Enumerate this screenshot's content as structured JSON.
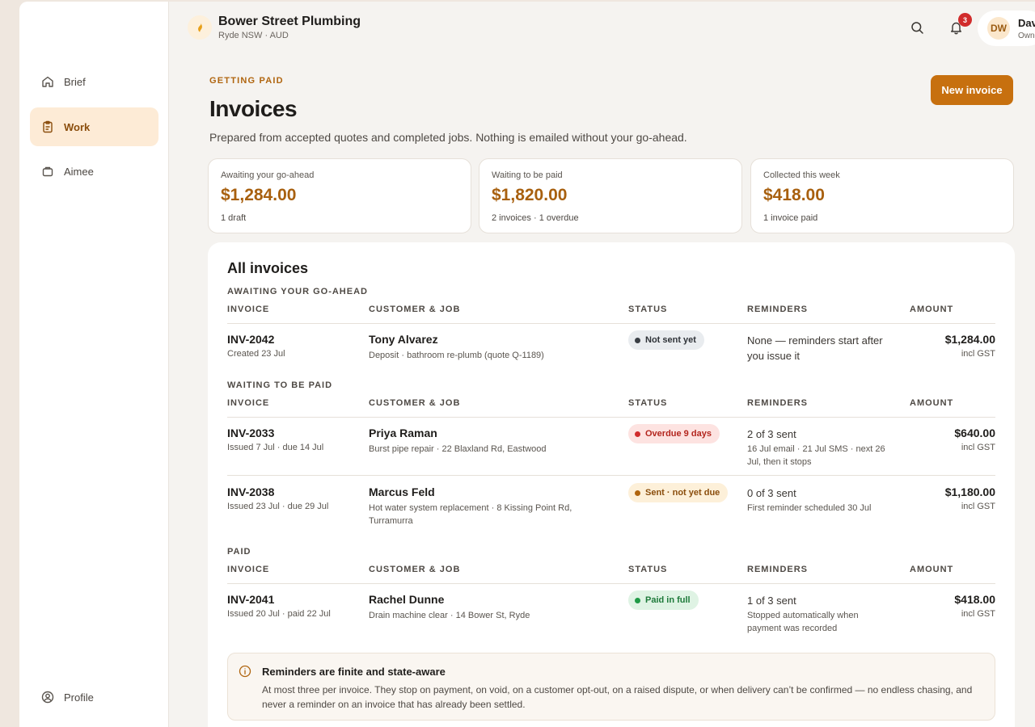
{
  "sidebar": {
    "items": [
      {
        "label": "Brief",
        "icon": "home-icon"
      },
      {
        "label": "Work",
        "icon": "clipboard-icon"
      },
      {
        "label": "Aimee",
        "icon": "bag-icon"
      }
    ],
    "profile": {
      "label": "Profile",
      "icon": "user-circle-icon"
    }
  },
  "topbar": {
    "business_name": "Bower Street Plumbing",
    "business_sub": "Ryde NSW · AUD",
    "notification_count": "3",
    "user_initials": "DW",
    "user_name": "Dave",
    "user_role": "Owner"
  },
  "header": {
    "eyebrow": "GETTING PAID",
    "title": "Invoices",
    "description": "Prepared from accepted quotes and completed jobs. Nothing is emailed without your go-ahead.",
    "new_button": "New invoice"
  },
  "stats": [
    {
      "label": "Awaiting your go-ahead",
      "value": "$1,284.00",
      "sub": "1 draft"
    },
    {
      "label": "Waiting to be paid",
      "value": "$1,820.00",
      "sub": "2 invoices · 1 overdue"
    },
    {
      "label": "Collected this week",
      "value": "$418.00",
      "sub": "1 invoice paid"
    }
  ],
  "invoices_panel": {
    "title": "All invoices",
    "columns": {
      "invoice": "INVOICE",
      "customer": "CUSTOMER & JOB",
      "status": "STATUS",
      "reminders": "REMINDERS",
      "amount": "AMOUNT"
    },
    "groups": [
      {
        "label": "AWAITING YOUR GO-AHEAD",
        "rows": [
          {
            "id": "INV-2042",
            "date": "Created 23 Jul",
            "customer": "Tony Alvarez",
            "job": "Deposit · bathroom re-plumb (quote Q-1189)",
            "status": "Not sent yet",
            "reminders": "None — reminders start after you issue it",
            "reminders_sub": "",
            "amount": "$1,284.00",
            "tax": "incl GST"
          }
        ]
      },
      {
        "label": "WAITING TO BE PAID",
        "rows": [
          {
            "id": "INV-2033",
            "date": "Issued 7 Jul · due 14 Jul",
            "customer": "Priya Raman",
            "job": "Burst pipe repair · 22 Blaxland Rd, Eastwood",
            "status": "Overdue 9 days",
            "reminders": "2 of 3 sent",
            "reminders_sub": "16 Jul email · 21 Jul SMS · next 26 Jul, then it stops",
            "amount": "$640.00",
            "tax": "incl GST"
          },
          {
            "id": "INV-2038",
            "date": "Issued 23 Jul · due 29 Jul",
            "customer": "Marcus Feld",
            "job": "Hot water system replacement · 8 Kissing Point Rd, Turramurra",
            "status": "Sent · not yet due",
            "reminders": "0 of 3 sent",
            "reminders_sub": "First reminder scheduled 30 Jul",
            "amount": "$1,180.00",
            "tax": "incl GST"
          }
        ]
      },
      {
        "label": "PAID",
        "rows": [
          {
            "id": "INV-2041",
            "date": "Issued 20 Jul · paid 22 Jul",
            "customer": "Rachel Dunne",
            "job": "Drain machine clear · 14 Bower St, Ryde",
            "status": "Paid in full",
            "reminders": "1 of 3 sent",
            "reminders_sub": "Stopped automatically when payment was recorded",
            "amount": "$418.00",
            "tax": "incl GST"
          }
        ]
      }
    ]
  },
  "callout": {
    "title": "Reminders are finite and state-aware",
    "body": "At most three per invoice. They stop on payment, on void, on a customer opt-out, on a raised dispute, or when delivery can’t be confirmed — no endless chasing, and never a reminder on an invoice that has already been settled."
  },
  "colors": {
    "accent": "#c7700f",
    "status_draft": "#e9ecef",
    "status_overdue": "#fde3e1",
    "status_pending": "#fdf0d9",
    "status_paid": "#dff3e4"
  }
}
